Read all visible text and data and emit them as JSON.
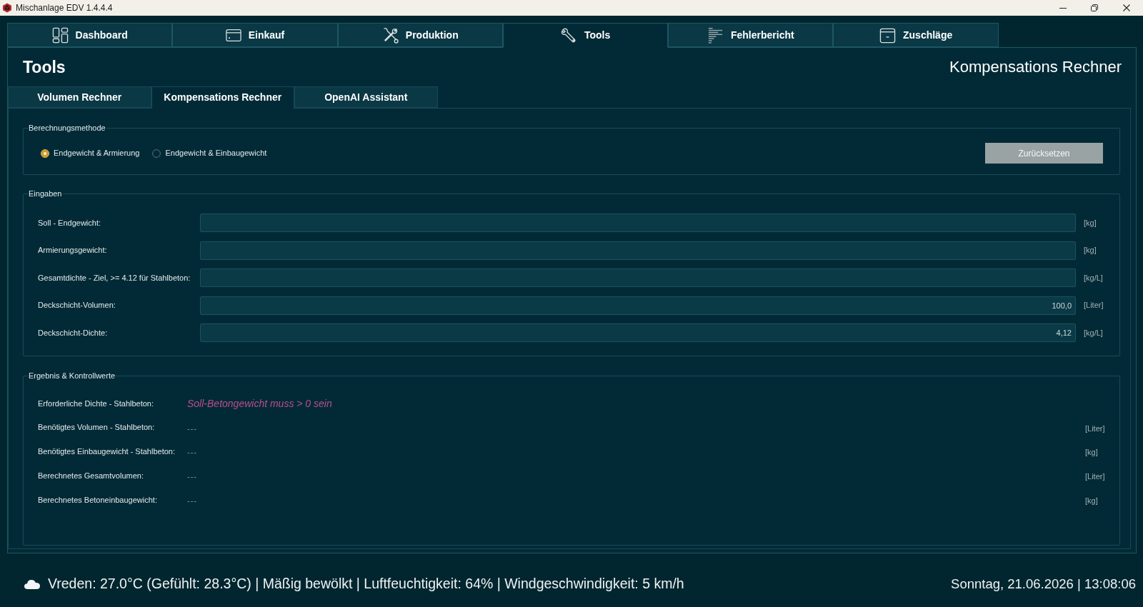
{
  "window": {
    "title": "Mischanlage EDV 1.4.4.4"
  },
  "tabs": [
    {
      "label": "Dashboard",
      "selected": false
    },
    {
      "label": "Einkauf",
      "selected": false
    },
    {
      "label": "Produktion",
      "selected": false
    },
    {
      "label": "Tools",
      "selected": true
    },
    {
      "label": "Fehlerbericht",
      "selected": false
    },
    {
      "label": "Zuschläge",
      "selected": false
    }
  ],
  "page": {
    "title": "Tools",
    "subtitle": "Kompensations Rechner"
  },
  "subtabs": [
    {
      "label": "Volumen Rechner",
      "selected": false
    },
    {
      "label": "Kompensations Rechner",
      "selected": true
    },
    {
      "label": "OpenAI Assistant",
      "selected": false
    }
  ],
  "method_group": {
    "title": "Berechnungsmethode",
    "options": [
      {
        "label": "Endgewicht & Armierung",
        "selected": true
      },
      {
        "label": "Endgewicht & Einbaugewicht",
        "selected": false
      }
    ],
    "reset_button": "Zurücksetzen"
  },
  "inputs_group": {
    "title": "Eingaben",
    "fields": [
      {
        "label": "Soll - Endgewicht:",
        "unit": "[kg]"
      },
      {
        "label": "Armierungsgewicht:",
        "unit": "[kg]"
      },
      {
        "label": "Gesamtdichte - Ziel, >= 4.12 für Stahlbeton:",
        "unit": "[kg/L]"
      },
      {
        "label": "Deckschicht-Volumen:",
        "value": "100,0",
        "unit": "[Liter]"
      },
      {
        "label": "Deckschicht-Dichte:",
        "value": "4,12",
        "unit": "[kg/L]"
      }
    ]
  },
  "results_group": {
    "title": "Ergebnis & Kontrollwerte",
    "rows": [
      {
        "label": "Erforderliche Dichte - Stahlbeton:",
        "value": "Soll-Betongewicht muss > 0 sein",
        "kind": "error"
      },
      {
        "label": "Benötigtes Volumen - Stahlbeton:",
        "value": "---",
        "unit": "[Liter]",
        "kind": "pending"
      },
      {
        "label": "Benötigtes Einbaugewicht - Stahlbeton:",
        "value": "---",
        "unit": "[kg]",
        "kind": "pending"
      },
      {
        "label": "Berechnetes Gesamtvolumen:",
        "value": "---",
        "unit": "[Liter]",
        "kind": "pending"
      },
      {
        "label": "Berechnetes Betoneinbaugewicht:",
        "value": "---",
        "unit": "[kg]",
        "kind": "pending"
      }
    ]
  },
  "status_bar": {
    "weather": "Vreden: 27.0°C (Gefühlt: 28.3°C) | Mäßig bewölkt | Luftfeuchtigkeit: 64% | Windgeschwindigkeit: 5 km/h",
    "datetime": "Sonntag, 21.06.2026 | 13:08:06"
  }
}
